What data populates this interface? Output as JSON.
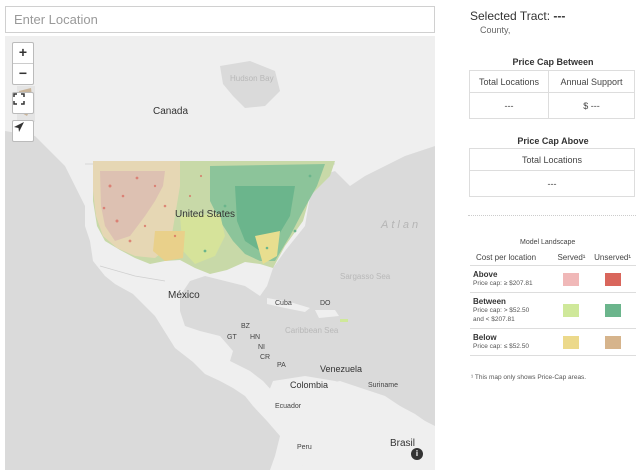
{
  "search": {
    "placeholder": "Enter Location"
  },
  "map": {
    "zoom_in": "+",
    "zoom_out": "−",
    "labels": {
      "canada": "Canada",
      "united_states": "United States",
      "mexico": "México",
      "cuba": "Cuba",
      "venezuela": "Venezuela",
      "colombia": "Colombia",
      "ecuador": "Ecuador",
      "peru": "Peru",
      "brasil": "Brasil",
      "suriname": "Suriname",
      "atlantic": "Atlan",
      "sargasso": "Sargasso Sea",
      "caribbean": "Caribbean Sea",
      "hudson": "Hudson Bay",
      "do": "DO",
      "bz": "BZ",
      "gt": "GT",
      "hn": "HN",
      "ni": "NI",
      "cr": "CR",
      "pa": "PA"
    }
  },
  "sidebar": {
    "selected_label": "Selected Tract:",
    "selected_value": "---",
    "county": "County,",
    "between": {
      "title": "Price Cap Between",
      "col1": "Total Locations",
      "col2": "Annual Support",
      "val1": "---",
      "val2": "$ ---"
    },
    "above": {
      "title": "Price Cap Above",
      "col1": "Total Locations",
      "val1": "---"
    },
    "legend": {
      "title": "Model Landscape",
      "col_cost": "Cost per location",
      "col_served": "Served¹",
      "col_unserved": "Unserved¹",
      "rows": [
        {
          "name": "Above",
          "sub": "Price cap: ≥ $207.81",
          "served": "#f0b8b8",
          "unserved": "#d9665c"
        },
        {
          "name": "Between",
          "sub": "Price cap: > $52.50",
          "sub2": "and < $207.81",
          "served": "#cfe89a",
          "unserved": "#6bb58c"
        },
        {
          "name": "Below",
          "sub": "Price cap: ≤ $52.50",
          "served": "#ecd98b",
          "unserved": "#d6b48c"
        }
      ],
      "footnote": "¹ This map only shows Price-Cap areas."
    }
  }
}
